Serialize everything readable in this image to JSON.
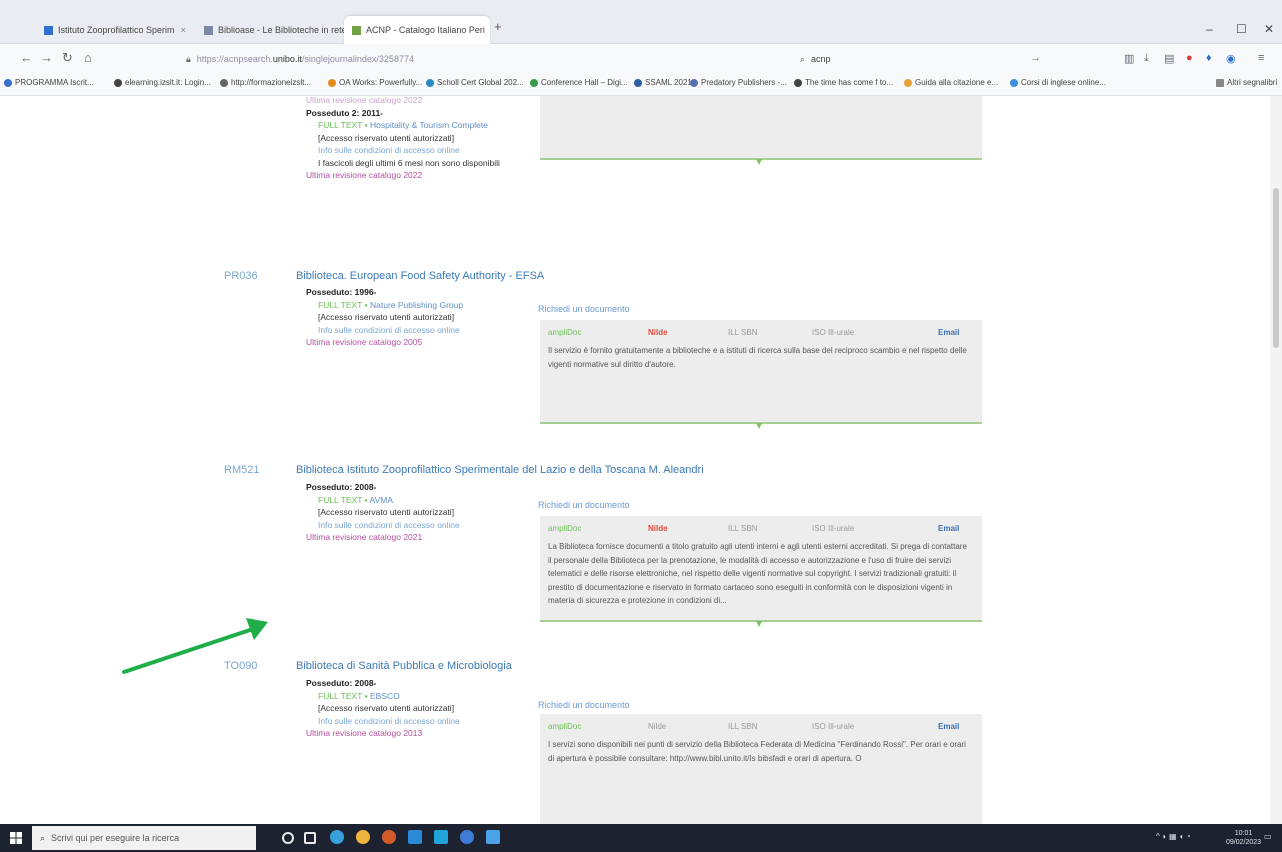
{
  "browser": {
    "tabs": [
      {
        "label": "Istituto Zooprofilattico Sperim",
        "close": "×",
        "active": false,
        "icon_color": "#2f6fcf"
      },
      {
        "label": "Biblioase - Le Biblioteche in rete di",
        "close": "×",
        "active": false,
        "icon_color": "#7a8aa6"
      },
      {
        "label": "ACNP - Catalogo Italiano Peri",
        "close": "×",
        "active": true,
        "icon_color": "#6fa245"
      }
    ],
    "new_tab": "+",
    "window_controls": {
      "minimize": "–",
      "maximize": "☐",
      "close": "✕"
    },
    "nav": {
      "back": "←",
      "forward": "→",
      "reload": "↻",
      "home": "⌂"
    },
    "url": {
      "prefix": "https://acnpsearch.",
      "domain": "unibo.it",
      "suffix": "/singlejournalindex/3258774"
    },
    "search": {
      "value": "acnp",
      "go": "→"
    },
    "toolbar_icons": [
      "≡"
    ],
    "bookmarks": [
      {
        "label": "PROGRAMMA Iscrit...",
        "color": "#3b6fcf"
      },
      {
        "label": "elearning.izslt.it: Login...",
        "color": "#444"
      },
      {
        "label": "http://formazioneizslt...",
        "color": "#666"
      },
      {
        "label": "OA Works: Powerfully...",
        "color": "#e08b1c"
      },
      {
        "label": "Scholl Cert Global 202...",
        "color": "#2a8ac4"
      },
      {
        "label": "Conference Hall – Digi...",
        "color": "#3a9b4c"
      },
      {
        "label": "SSAML 2021",
        "color": "#2d5fa8"
      },
      {
        "label": "Predatory Publishers -...",
        "color": "#5a6fb0"
      },
      {
        "label": "The time has come f to...",
        "color": "#444"
      },
      {
        "label": "Guida alla citazione e...",
        "color": "#e6a33a"
      },
      {
        "label": "Corsi di inglese online...",
        "color": "#3d8ee0"
      },
      {
        "label": "Altri segnalibri",
        "color": "#888"
      }
    ]
  },
  "page": {
    "top_entry": {
      "partial_rev": "Ultima revisione catalogo 2022",
      "poss": "Posseduto 2: 2011-",
      "ft_prefix": "FULL TEXT ▪",
      "ft_source": "Hospitality & Tourism Complete",
      "access": "[Accesso riservato utenti autorizzati]",
      "info": "Info sulle condizioni di accesso online",
      "missing": "I fascicoli degli ultimi 6 mesi non sono disponibili",
      "rev": "Ultima revisione catalogo 2022"
    },
    "libraries": [
      {
        "code": "PR036",
        "name": "Biblioteca. European Food Safety Authority - EFSA",
        "poss": "Posseduto: 1996-",
        "ft_prefix": "FULL TEXT ▪",
        "ft_source": "Nature Publishing Group",
        "access": "[Accesso riservato utenti autorizzati]",
        "info": "Info sulle condizioni di accesso online",
        "rev": "Ultima revisione catalogo 2005",
        "req_link": "Richiedi un documento",
        "svc": "ampliDoc",
        "price": "Nilde",
        "price_style": "red",
        "date": "ILL SBN",
        "mode": "ISO Ill-urale",
        "mail": "Email",
        "text": "Il servizio è fornito gratuitamente a biblioteche e a istituti di ricerca sulla base del reciproco scambio e nel rispetto delle vigenti normative sul diritto d'autore."
      },
      {
        "code": "RM521",
        "name": "Biblioteca Istituto Zooprofilattico Sperimentale del Lazio e della Toscana M. Aleandri",
        "poss": "Posseduto: 2008-",
        "ft_prefix": "FULL TEXT ▪",
        "ft_source": "AVMA",
        "access": "[Accesso riservato utenti autorizzati]",
        "info": "Info sulle condizioni di accesso online",
        "rev": "Ultima revisione catalogo 2021",
        "req_link": "Richiedi un documento",
        "svc": "ampliDoc",
        "price": "Nilde",
        "price_style": "red",
        "date": "ILL SBN",
        "mode": "ISO Ill-urale",
        "mail": "Email",
        "text": "La Biblioteca fornisce documenti a titolo gratuito agli utenti interni e agli utenti esterni accreditati. Si prega di contattare il personale della Biblioteca per la prenotazione, le modalità di accesso e autorizzazione e l'uso di fruire dei servizi telematici e delle risorse elettroniche, nel rispetto delle vigenti normative sul copyright. I servizi tradizionali gratuiti: il prestito di documentazione e riservato in formato cartaceo sono eseguiti in conformità con le disposizioni vigenti in materia di sicurezza e protezione in condizioni di..."
      },
      {
        "code": "TO090",
        "name": "Biblioteca di Sanità Pubblica e Microbiologia",
        "poss": "Posseduto: 2008-",
        "ft_prefix": "FULL TEXT ▪",
        "ft_source": "EBSCO",
        "access": "[Accesso riservato utenti autorizzati]",
        "info": "Info sulle condizioni di accesso online",
        "rev": "Ultima revisione catalogo 2013",
        "req_link": "Richiedi un documento",
        "svc": "ampliDoc",
        "price": "Nilde",
        "price_style": "grey",
        "date": "ILL SBN",
        "mode": "ISO Ill-urale",
        "mail": "Email",
        "text": "I servizi sono disponibili nei punti di servizio della Biblioteca Federata di Medicina \"Ferdinando Rossi\". Per orari e orari di apertura è possibile consultare: http://www.bibl.unito.it/Is bibsfadi e orari di apertura. O"
      }
    ]
  },
  "taskbar": {
    "search_placeholder": "Scrivi qui per eseguire la ricerca",
    "search_glyph": "⌕",
    "tray_text": "^ ◗ ▦ ◖ ◔",
    "clock_time": "10:01",
    "clock_date": "09/02/2023",
    "apps": [
      "#e9e9e9",
      "#3d86d8",
      "#39a0e0",
      "#f0b33c",
      "#d35b2a",
      "#2a8ad8",
      "#1ea4d8",
      "#3d7bd6",
      "#4aa3e8"
    ]
  }
}
